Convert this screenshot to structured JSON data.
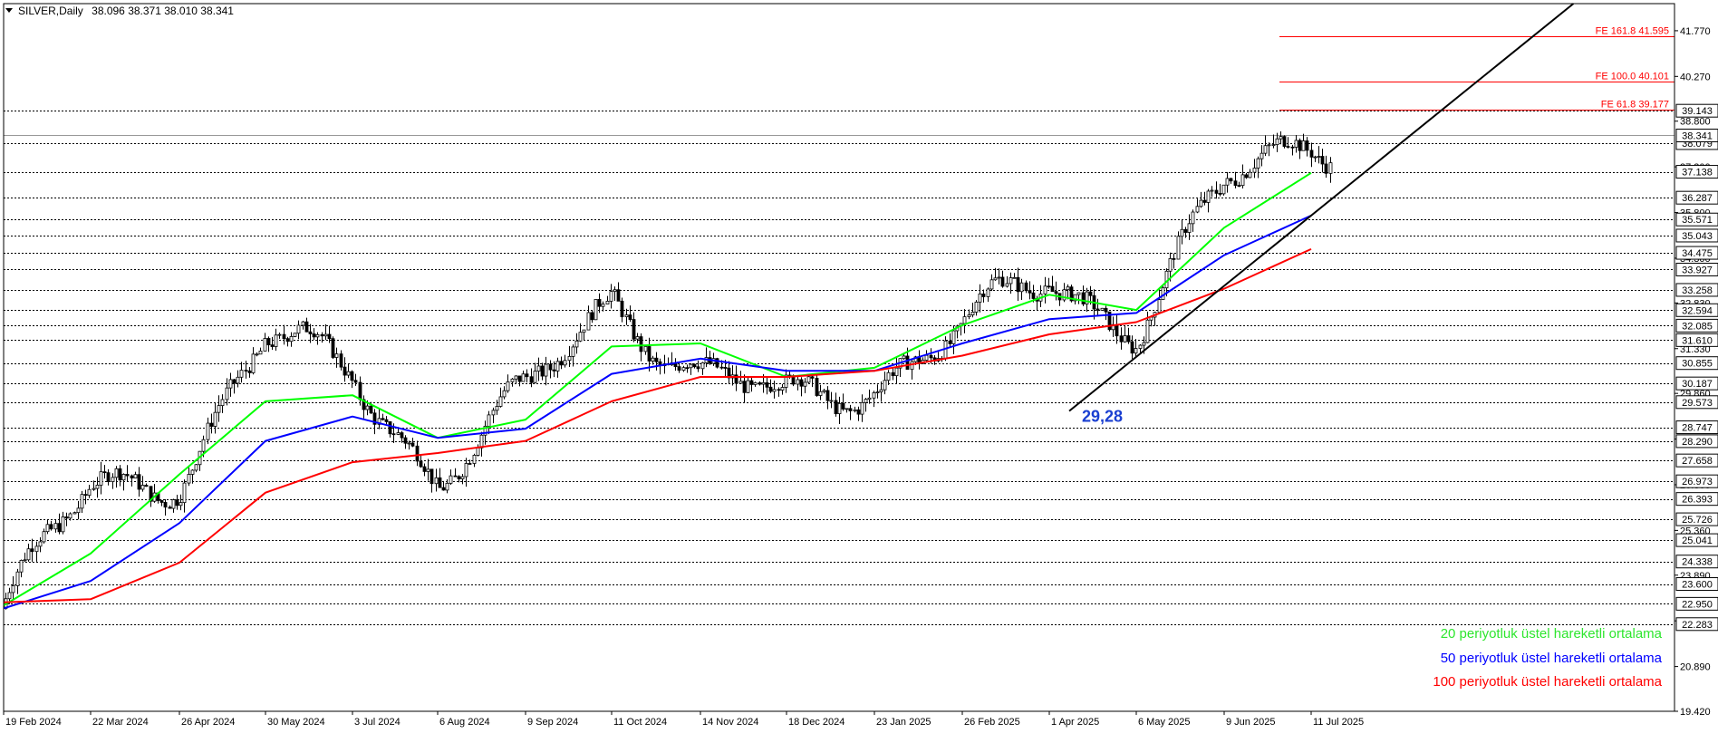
{
  "header": {
    "symbol_timeframe": "SILVER,Daily",
    "ohlc": "38.096 38.371 38.010 38.341"
  },
  "chart_data": {
    "type": "candlestick",
    "y_axis": {
      "min": 19.42,
      "max": 42.66,
      "ticks": [
        "41.770",
        "40.270",
        "38.800",
        "37.300",
        "35.800",
        "34.300",
        "32.830",
        "31.330",
        "29.860",
        "28.360",
        "26.860",
        "25.360",
        "23.890",
        "22.390",
        "20.890",
        "19.420"
      ]
    },
    "x_axis": {
      "labels": [
        "19 Feb 2024",
        "22 Mar 2024",
        "26 Apr 2024",
        "30 May 2024",
        "3 Jul 2024",
        "6 Aug 2024",
        "9 Sep 2024",
        "11 Oct 2024",
        "14 Nov 2024",
        "18 Dec 2024",
        "23 Jan 2025",
        "26 Feb 2025",
        "1 Apr 2025",
        "6 May 2025",
        "9 Jun 2025",
        "11 Jul 2025"
      ]
    },
    "horizontal_levels": [
      "39.143",
      "38.079",
      "37.138",
      "36.287",
      "35.571",
      "35.043",
      "34.475",
      "33.927",
      "33.258",
      "32.594",
      "32.085",
      "31.610",
      "30.855",
      "30.187",
      "29.573",
      "28.747",
      "28.290",
      "27.658",
      "26.973",
      "26.393",
      "25.726",
      "25.041",
      "24.338",
      "23.600",
      "22.950",
      "22.283"
    ],
    "current_price": "38.341",
    "fibonacci_extensions": [
      {
        "label": "FE 161.8 41.595",
        "value": 41.595
      },
      {
        "label": "FE 100.0 40.101",
        "value": 40.101
      },
      {
        "label": "FE 61.8 39.177",
        "value": 39.177
      }
    ],
    "annotation": "29,28",
    "trendline": {
      "from": {
        "date": "~7 Apr 2025",
        "price": 29.28
      },
      "to": {
        "date": "11 Jul 2025",
        "price": 35.7
      }
    },
    "series": [
      {
        "name": "20 periyotluk üstel hareketli ortalama",
        "color": "#00ff00",
        "points": [
          [
            "19 Feb 2024",
            22.9
          ],
          [
            "22 Mar 2024",
            24.6
          ],
          [
            "26 Apr 2024",
            27.2
          ],
          [
            "30 May 2024",
            29.6
          ],
          [
            "3 Jul 2024",
            29.8
          ],
          [
            "6 Aug 2024",
            28.4
          ],
          [
            "9 Sep 2024",
            29.0
          ],
          [
            "11 Oct 2024",
            31.4
          ],
          [
            "14 Nov 2024",
            31.5
          ],
          [
            "18 Dec 2024",
            30.4
          ],
          [
            "23 Jan 2025",
            30.7
          ],
          [
            "26 Feb 2025",
            32.1
          ],
          [
            "1 Apr 2025",
            33.1
          ],
          [
            "6 May 2025",
            32.6
          ],
          [
            "9 Jun 2025",
            35.3
          ],
          [
            "11 Jul 2025",
            37.1
          ]
        ]
      },
      {
        "name": "50 periyotluk üstel hareketli ortalama",
        "color": "#0000ff",
        "points": [
          [
            "19 Feb 2024",
            22.8
          ],
          [
            "22 Mar 2024",
            23.7
          ],
          [
            "26 Apr 2024",
            25.6
          ],
          [
            "30 May 2024",
            28.3
          ],
          [
            "3 Jul 2024",
            29.1
          ],
          [
            "6 Aug 2024",
            28.4
          ],
          [
            "9 Sep 2024",
            28.7
          ],
          [
            "11 Oct 2024",
            30.5
          ],
          [
            "14 Nov 2024",
            31.0
          ],
          [
            "18 Dec 2024",
            30.6
          ],
          [
            "23 Jan 2025",
            30.6
          ],
          [
            "26 Feb 2025",
            31.5
          ],
          [
            "1 Apr 2025",
            32.3
          ],
          [
            "6 May 2025",
            32.5
          ],
          [
            "9 Jun 2025",
            34.4
          ],
          [
            "11 Jul 2025",
            35.7
          ]
        ]
      },
      {
        "name": "100 periyotluk üstel hareketli ortalama",
        "color": "#ff0000",
        "points": [
          [
            "19 Feb 2024",
            23.0
          ],
          [
            "22 Mar 2024",
            23.1
          ],
          [
            "26 Apr 2024",
            24.3
          ],
          [
            "30 May 2024",
            26.6
          ],
          [
            "3 Jul 2024",
            27.6
          ],
          [
            "6 Aug 2024",
            27.9
          ],
          [
            "9 Sep 2024",
            28.3
          ],
          [
            "11 Oct 2024",
            29.6
          ],
          [
            "14 Nov 2024",
            30.4
          ],
          [
            "18 Dec 2024",
            30.4
          ],
          [
            "23 Jan 2025",
            30.6
          ],
          [
            "26 Feb 2025",
            31.1
          ],
          [
            "1 Apr 2025",
            31.8
          ],
          [
            "6 May 2025",
            32.2
          ],
          [
            "9 Jun 2025",
            33.3
          ],
          [
            "11 Jul 2025",
            34.6
          ]
        ]
      }
    ],
    "price_path": [
      [
        "19 Feb 2024",
        22.8
      ],
      [
        "22 Mar 2024",
        26.6
      ],
      [
        "26 Apr 2024",
        27.4
      ],
      [
        "30 May 2024",
        31.5
      ],
      [
        "3 Jul 2024",
        30.6
      ],
      [
        "6 Aug 2024",
        27.2
      ],
      [
        "9 Sep 2024",
        29.6
      ],
      [
        "11 Oct 2024",
        33.2
      ],
      [
        "14 Nov 2024",
        30.4
      ],
      [
        "18 Dec 2024",
        29.5
      ],
      [
        "23 Jan 2025",
        30.4
      ],
      [
        "26 Feb 2025",
        31.9
      ],
      [
        "1 Apr 2025",
        33.6
      ],
      [
        "6 May 2025",
        32.2
      ],
      [
        "9 Jun 2025",
        36.5
      ],
      [
        "11 Jul 2025",
        38.3
      ]
    ]
  }
}
